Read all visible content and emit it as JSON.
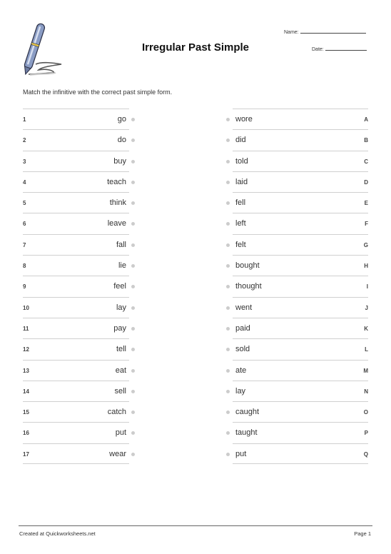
{
  "header": {
    "title": "Irregular Past Simple",
    "name_label": "Name:",
    "date_label": "Date:",
    "logo_icon": "pen-writing-icon"
  },
  "instructions": "Match the infinitive with the correct past simple form.",
  "left_items": [
    {
      "num": "1",
      "word": "go"
    },
    {
      "num": "2",
      "word": "do"
    },
    {
      "num": "3",
      "word": "buy"
    },
    {
      "num": "4",
      "word": "teach"
    },
    {
      "num": "5",
      "word": "think"
    },
    {
      "num": "6",
      "word": "leave"
    },
    {
      "num": "7",
      "word": "fall"
    },
    {
      "num": "8",
      "word": "lie"
    },
    {
      "num": "9",
      "word": "feel"
    },
    {
      "num": "10",
      "word": "lay"
    },
    {
      "num": "11",
      "word": "pay"
    },
    {
      "num": "12",
      "word": "tell"
    },
    {
      "num": "13",
      "word": "eat"
    },
    {
      "num": "14",
      "word": "sell"
    },
    {
      "num": "15",
      "word": "catch"
    },
    {
      "num": "16",
      "word": "put"
    },
    {
      "num": "17",
      "word": "wear"
    }
  ],
  "right_items": [
    {
      "letter": "A",
      "word": "wore"
    },
    {
      "letter": "B",
      "word": "did"
    },
    {
      "letter": "C",
      "word": "told"
    },
    {
      "letter": "D",
      "word": "laid"
    },
    {
      "letter": "E",
      "word": "fell"
    },
    {
      "letter": "F",
      "word": "left"
    },
    {
      "letter": "G",
      "word": "felt"
    },
    {
      "letter": "H",
      "word": "bought"
    },
    {
      "letter": "I",
      "word": "thought"
    },
    {
      "letter": "J",
      "word": "went"
    },
    {
      "letter": "K",
      "word": "paid"
    },
    {
      "letter": "L",
      "word": "sold"
    },
    {
      "letter": "M",
      "word": "ate"
    },
    {
      "letter": "N",
      "word": "lay"
    },
    {
      "letter": "O",
      "word": "caught"
    },
    {
      "letter": "P",
      "word": "taught"
    },
    {
      "letter": "Q",
      "word": "put"
    }
  ],
  "footer": {
    "credit": "Created at Quickworksheets.net",
    "page": "Page 1"
  }
}
